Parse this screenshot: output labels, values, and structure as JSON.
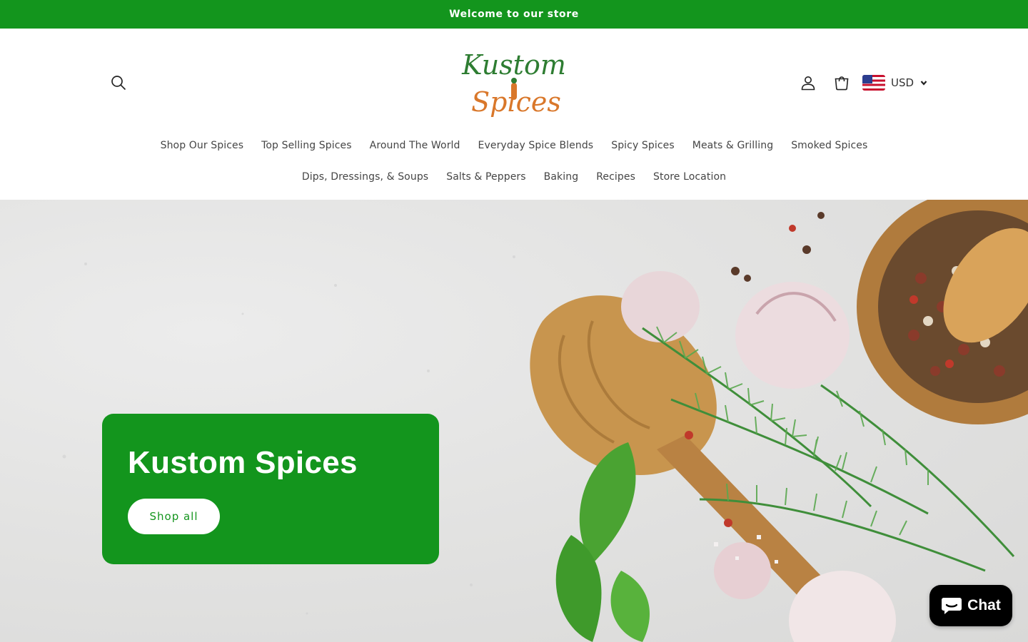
{
  "announcement": {
    "text": "Welcome to our store"
  },
  "header": {
    "logo": {
      "line1": "Kustom",
      "line2": "Spices"
    },
    "icons": {
      "search": "search-icon",
      "account": "account-icon",
      "cart": "cart-icon",
      "dropdown": "chevron-down-icon",
      "flag": "us-flag-icon"
    },
    "currency": {
      "code": "USD"
    }
  },
  "nav": {
    "row1": [
      "Shop Our Spices",
      "Top Selling Spices",
      "Around The World",
      "Everyday Spice Blends",
      "Spicy Spices",
      "Meats & Grilling",
      "Smoked Spices"
    ],
    "row2": [
      "Dips, Dressings, & Soups",
      "Salts & Peppers",
      "Baking",
      "Recipes",
      "Store Location"
    ]
  },
  "hero": {
    "title": "Kustom Spices",
    "button_label": "Shop all"
  },
  "chat": {
    "label": "Chat",
    "icon": "chat-bubble-icon"
  },
  "colors": {
    "brand_green": "#13951d",
    "logo_green": "#2e7d32",
    "logo_orange": "#d9772a",
    "chat_black": "#000000"
  }
}
